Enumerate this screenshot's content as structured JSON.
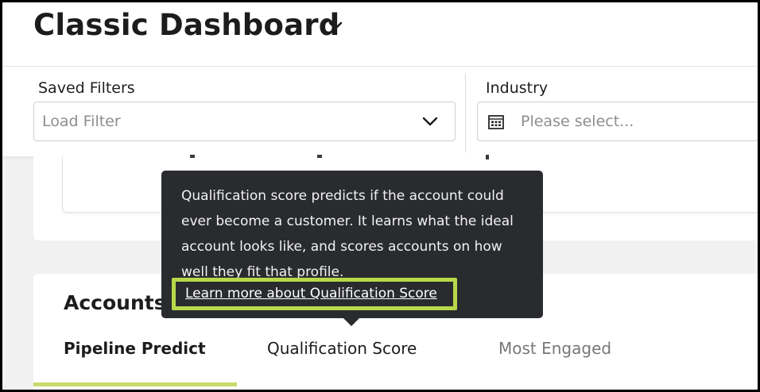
{
  "header": {
    "title": "Classic Dashboard"
  },
  "filters": {
    "saved_filters": {
      "label": "Saved Filters",
      "placeholder": "Load Filter"
    },
    "industry": {
      "label": "Industry",
      "placeholder": "Please select..."
    }
  },
  "tooltip": {
    "text": "Qualification score predicts if the account could ever become a customer. It learns what the ideal account looks like, and scores accounts on how well they fit that profile.",
    "link": "Learn more about Qualification Score"
  },
  "accounts": {
    "title": "Accounts",
    "tabs": [
      {
        "label": "Pipeline Predict",
        "active": true
      },
      {
        "label": "Qualification Score",
        "active": false
      },
      {
        "label": "Most Engaged",
        "active": false
      }
    ]
  },
  "colors": {
    "accent": "#b7d84a",
    "tab_active": "#c5dc6a",
    "tooltip_bg": "#292b2e",
    "text_dark": "#1c1c1c"
  },
  "icons": {
    "title_caret": "chevron-down-icon",
    "select_chevron": "chevron-down-icon",
    "industry_icon": "building-icon"
  }
}
